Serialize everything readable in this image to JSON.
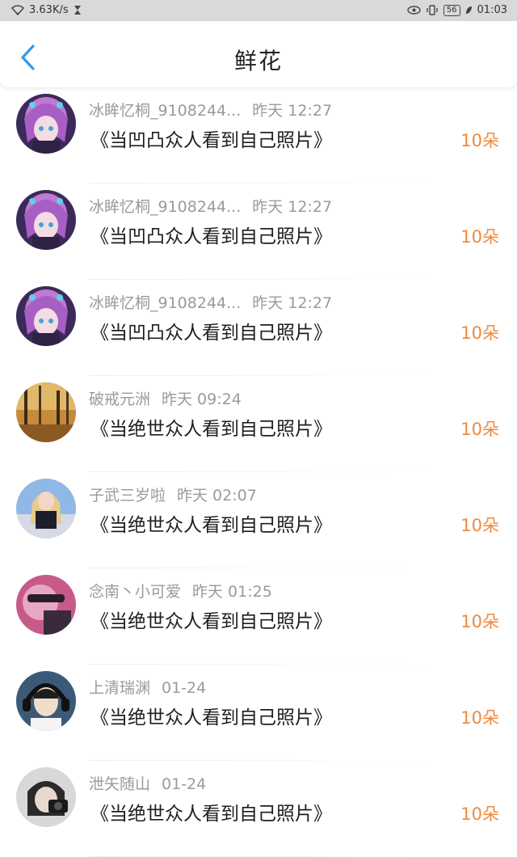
{
  "status_bar": {
    "net_speed": "3.63K/s",
    "battery": "56",
    "time": "01:03"
  },
  "header": {
    "title": "鲜花"
  },
  "colors": {
    "accent_blue": "#2e9bf0",
    "count_orange": "#ef8a3c"
  },
  "items": [
    {
      "name": "冰眸忆桐_9108244...",
      "time": "昨天 12:27",
      "gift": "《当凹凸众人看到自己照片》",
      "count": "10朵",
      "avatar": "anime-girl-avatar"
    },
    {
      "name": "冰眸忆桐_9108244...",
      "time": "昨天 12:27",
      "gift": "《当凹凸众人看到自己照片》",
      "count": "10朵",
      "avatar": "anime-girl-avatar"
    },
    {
      "name": "冰眸忆桐_9108244...",
      "time": "昨天 12:27",
      "gift": "《当凹凸众人看到自己照片》",
      "count": "10朵",
      "avatar": "anime-girl-avatar"
    },
    {
      "name": "破戒元洲",
      "time": "昨天 09:24",
      "gift": "《当绝世众人看到自己照片》",
      "count": "10朵",
      "avatar": "forest-avatar"
    },
    {
      "name": "子武三岁啦",
      "time": "昨天 02:07",
      "gift": "《当绝世众人看到自己照片》",
      "count": "10朵",
      "avatar": "blonde-girl-avatar"
    },
    {
      "name": "念南丶小可爱",
      "time": "昨天 01:25",
      "gift": "《当绝世众人看到自己照片》",
      "count": "10朵",
      "avatar": "pink-character-avatar"
    },
    {
      "name": "上清瑞渊",
      "time": "01-24",
      "gift": "《当绝世众人看到自己照片》",
      "count": "10朵",
      "avatar": "headphone-boy-avatar"
    },
    {
      "name": "泄矢随山",
      "time": "01-24",
      "gift": "《当绝世众人看到自己照片》",
      "count": "10朵",
      "avatar": "camera-boy-avatar"
    }
  ]
}
